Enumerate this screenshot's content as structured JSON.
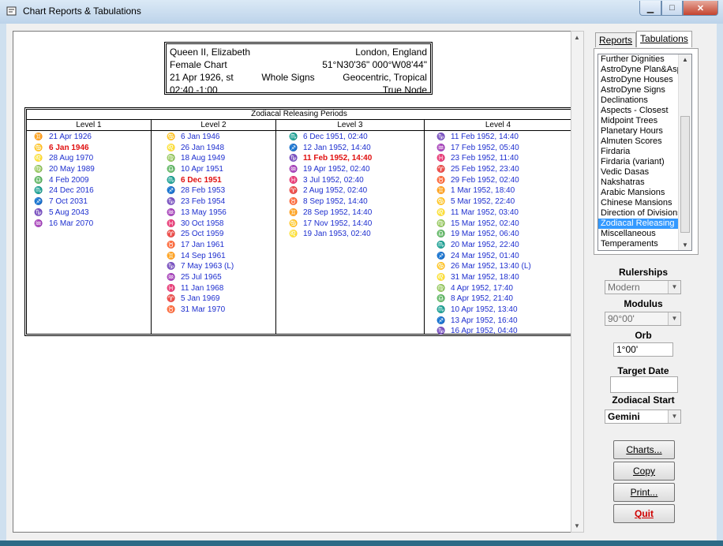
{
  "window": {
    "title": "Chart Reports & Tabulations"
  },
  "chart_info": {
    "name": "Queen II, Elizabeth",
    "location": "London, England",
    "chart_type": "Female Chart",
    "coords": "51°N30'36\"  000°W08'44\"",
    "date": "21 Apr 1926, st",
    "house_system": "Whole Signs",
    "zodiac": "Geocentric, Tropical",
    "time": "02:40 -1:00",
    "node": "True Node"
  },
  "zr": {
    "title": "Zodiacal Releasing Periods",
    "headers": [
      "Level 1",
      "Level 2",
      "Level 3",
      "Level 4"
    ],
    "level1": [
      {
        "g": "♊",
        "t": "21 Apr 1926"
      },
      {
        "g": "♋",
        "t": "6 Jan 1946"
      },
      {
        "g": "♌",
        "t": "28 Aug 1970"
      },
      {
        "g": "♍",
        "t": "20 May 1989"
      },
      {
        "g": "♎",
        "t": "4 Feb 2009"
      },
      {
        "g": "♏",
        "t": "24 Dec 2016"
      },
      {
        "g": "♐",
        "t": "7 Oct 2031"
      },
      {
        "g": "♑",
        "t": "5 Aug 2043"
      },
      {
        "g": "♒",
        "t": "16 Mar 2070"
      }
    ],
    "level2": [
      {
        "g": "♋",
        "t": "6 Jan 1946"
      },
      {
        "g": "♌",
        "t": "26 Jan 1948"
      },
      {
        "g": "♍",
        "t": "18 Aug 1949"
      },
      {
        "g": "♎",
        "t": "10 Apr 1951"
      },
      {
        "g": "♏",
        "t": "6 Dec 1951"
      },
      {
        "g": "♐",
        "t": "28 Feb 1953"
      },
      {
        "g": "♑",
        "t": "23 Feb 1954"
      },
      {
        "g": "♒",
        "t": "13 May 1956"
      },
      {
        "g": "♓",
        "t": "30 Oct 1958"
      },
      {
        "g": "♈",
        "t": "25 Oct 1959"
      },
      {
        "g": "♉",
        "t": "17 Jan 1961"
      },
      {
        "g": "♊",
        "t": "14 Sep 1961"
      },
      {
        "g": "♑",
        "t": "7 May 1963 (L)"
      },
      {
        "g": "♒",
        "t": "25 Jul 1965"
      },
      {
        "g": "♓",
        "t": "11 Jan 1968"
      },
      {
        "g": "♈",
        "t": "5 Jan 1969"
      },
      {
        "g": "♉",
        "t": "31 Mar 1970"
      }
    ],
    "level3": [
      {
        "g": "♏",
        "t": "6 Dec 1951, 02:40"
      },
      {
        "g": "♐",
        "t": "12 Jan 1952, 14:40"
      },
      {
        "g": "♑",
        "t": "11 Feb 1952, 14:40"
      },
      {
        "g": "♒",
        "t": "19 Apr 1952, 02:40"
      },
      {
        "g": "♓",
        "t": "3 Jul 1952, 02:40"
      },
      {
        "g": "♈",
        "t": "2 Aug 1952, 02:40"
      },
      {
        "g": "♉",
        "t": "8 Sep 1952, 14:40"
      },
      {
        "g": "♊",
        "t": "28 Sep 1952, 14:40"
      },
      {
        "g": "♋",
        "t": "17 Nov 1952, 14:40"
      },
      {
        "g": "♌",
        "t": "19 Jan 1953, 02:40"
      }
    ],
    "level4": [
      {
        "g": "♑",
        "t": "11 Feb 1952, 14:40"
      },
      {
        "g": "♒",
        "t": "17 Feb 1952, 05:40"
      },
      {
        "g": "♓",
        "t": "23 Feb 1952, 11:40"
      },
      {
        "g": "♈",
        "t": "25 Feb 1952, 23:40"
      },
      {
        "g": "♉",
        "t": "29 Feb 1952, 02:40"
      },
      {
        "g": "♊",
        "t": "1 Mar 1952, 18:40"
      },
      {
        "g": "♋",
        "t": "5 Mar 1952, 22:40"
      },
      {
        "g": "♌",
        "t": "11 Mar 1952, 03:40"
      },
      {
        "g": "♍",
        "t": "15 Mar 1952, 02:40"
      },
      {
        "g": "♎",
        "t": "19 Mar 1952, 06:40"
      },
      {
        "g": "♏",
        "t": "20 Mar 1952, 22:40"
      },
      {
        "g": "♐",
        "t": "24 Mar 1952, 01:40"
      },
      {
        "g": "♋",
        "t": "26 Mar 1952, 13:40 (L)"
      },
      {
        "g": "♌",
        "t": "31 Mar 1952, 18:40"
      },
      {
        "g": "♍",
        "t": "4 Apr 1952, 17:40"
      },
      {
        "g": "♎",
        "t": "8 Apr 1952, 21:40"
      },
      {
        "g": "♏",
        "t": "10 Apr 1952, 13:40"
      },
      {
        "g": "♐",
        "t": "13 Apr 1952, 16:40"
      },
      {
        "g": "♑",
        "t": "16 Apr 1952, 04:40"
      }
    ]
  },
  "tabs": [
    "Reports",
    "Tabulations"
  ],
  "tab_list": [
    "Further Dignities",
    "AstroDyne Plan&Asp",
    "AstroDyne Houses",
    "AstroDyne Signs",
    "Declinations",
    "Aspects - Closest",
    "Midpoint Trees",
    "Planetary Hours",
    "Almuten Scores",
    "Firdaria",
    "Firdaria (variant)",
    "Vedic Dasas",
    "Nakshatras",
    "Arabic Mansions",
    "Chinese Mansions",
    "Direction of Divisions",
    "Zodiacal Releasing",
    "Miscellaneous",
    "Temperaments"
  ],
  "controls": {
    "rulerships_label": "Rulerships",
    "rulerships_value": "Modern",
    "modulus_label": "Modulus",
    "modulus_value": "90°00'",
    "orb_label": "Orb",
    "orb_value": "1°00'",
    "target_date_label": "Target Date",
    "target_date_value": "",
    "zodiacal_start_label": "Zodiacal Start",
    "zodiacal_start_value": "Gemini"
  },
  "buttons": {
    "charts": "Charts...",
    "copy": "Copy",
    "print": "Print...",
    "quit": "Quit"
  }
}
